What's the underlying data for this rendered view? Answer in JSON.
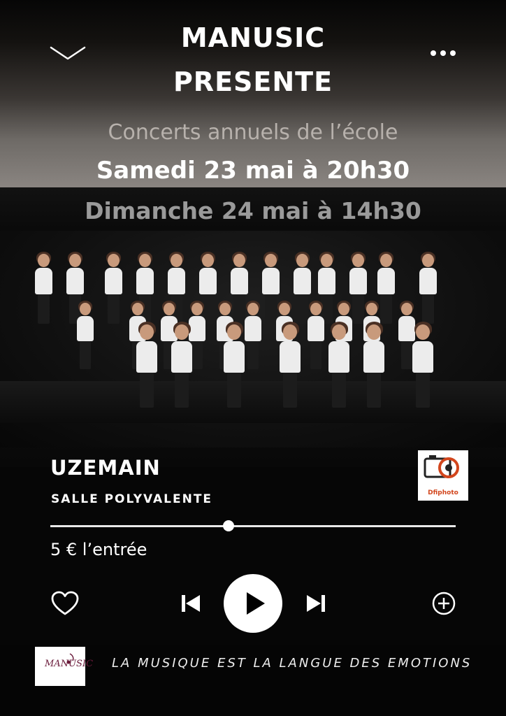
{
  "header": {
    "title_line1": "MANUSIC",
    "title_line2": "PRESENTE",
    "collapse_icon": "chevron-down-icon",
    "more_icon": "more-dots-icon"
  },
  "event": {
    "tagline": "Concerts annuels de l’école",
    "date_saturday": "Samedi 23 mai à 20h30",
    "date_sunday": "Dimanche 24 mai à 14h30"
  },
  "venue": {
    "city": "UZEMAIN",
    "hall": "SALLE POLYVALENTE",
    "photographer_logo_text": "Dfiphoto"
  },
  "player": {
    "progress": 0.44,
    "price": "5 € l’entrée",
    "like_icon": "heart-icon",
    "prev_icon": "skip-previous-icon",
    "play_icon": "play-icon",
    "next_icon": "skip-next-icon",
    "add_icon": "add-circle-icon"
  },
  "footer": {
    "brand_logo_text": "MANUSIC",
    "motto": "LA MUSIQUE EST LA LANGUE DES EMOTIONS"
  },
  "colors": {
    "background": "#060606",
    "accent": "#ffffff",
    "muted_text": "#9a9a9a"
  }
}
